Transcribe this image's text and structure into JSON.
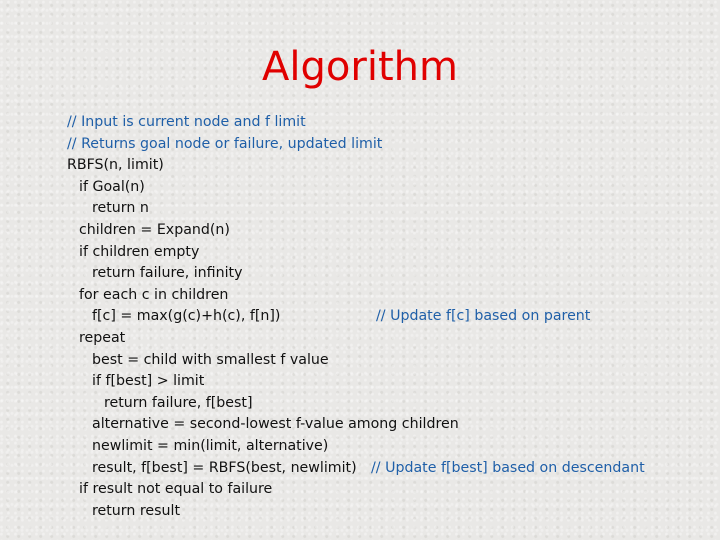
{
  "slide": {
    "title": "Algorithm",
    "accent_color": "#e00000",
    "comment_color": "#1f5fa8"
  },
  "code": {
    "lines": [
      {
        "indent": 0,
        "text": "// Input is current node and f limit",
        "kind": "comment"
      },
      {
        "indent": 0,
        "text": "// Returns goal node or failure, updated limit",
        "kind": "comment"
      },
      {
        "indent": 0,
        "text": "RBFS(n, limit)",
        "kind": "code"
      },
      {
        "indent": 1,
        "text": "if Goal(n)",
        "kind": "code"
      },
      {
        "indent": 2,
        "text": "return n",
        "kind": "code"
      },
      {
        "indent": 1,
        "text": "children = Expand(n)",
        "kind": "code"
      },
      {
        "indent": 1,
        "text": "if children empty",
        "kind": "code"
      },
      {
        "indent": 2,
        "text": "return failure, infinity",
        "kind": "code"
      },
      {
        "indent": 1,
        "text": "for each c in children",
        "kind": "code"
      },
      {
        "indent": 2,
        "text": "f[c] = max(g(c)+h(c), f[n])",
        "kind": "code",
        "comment": "// Update f[c] based on parent"
      },
      {
        "indent": 1,
        "text": "repeat",
        "kind": "code"
      },
      {
        "indent": 2,
        "text": "best = child with smallest f value",
        "kind": "code"
      },
      {
        "indent": 2,
        "text": "if f[best] > limit",
        "kind": "code"
      },
      {
        "indent": 3,
        "text": "return failure, f[best]",
        "kind": "code"
      },
      {
        "indent": 2,
        "text": "alternative = second-lowest f-value among children",
        "kind": "code"
      },
      {
        "indent": 2,
        "text": "newlimit = min(limit, alternative)",
        "kind": "code"
      },
      {
        "indent": 2,
        "text": "result, f[best] = RBFS(best, newlimit)",
        "kind": "code",
        "comment": "// Update f[best] based on descendant"
      },
      {
        "indent": 1,
        "text": "if result not equal to failure",
        "kind": "code"
      },
      {
        "indent": 2,
        "text": "return result",
        "kind": "code"
      }
    ]
  }
}
